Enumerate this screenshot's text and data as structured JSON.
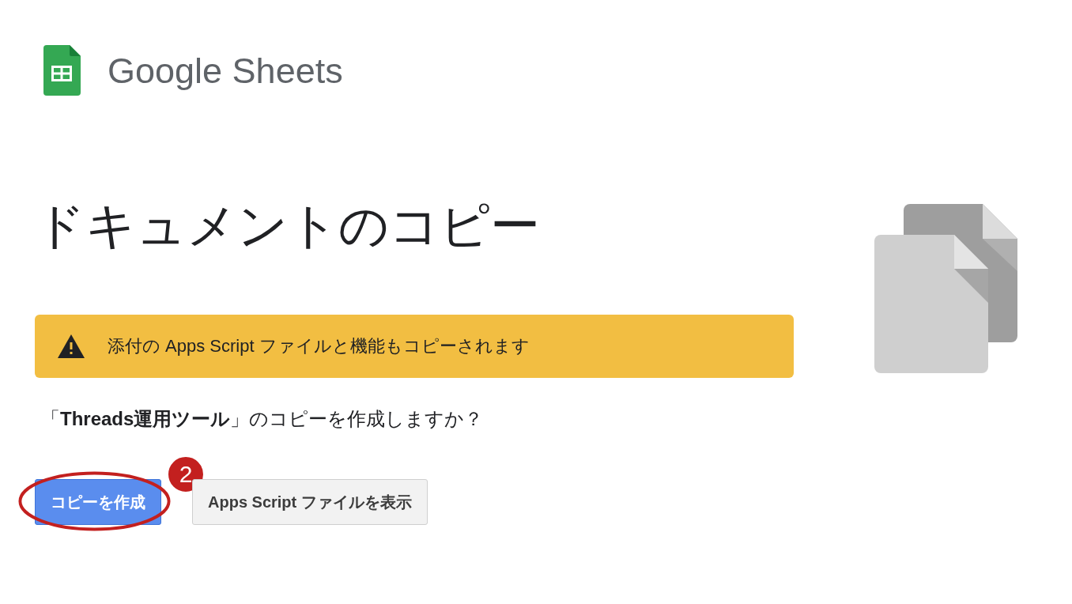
{
  "header": {
    "logo_text": "Google Sheets"
  },
  "title": "ドキュメントのコピー",
  "warning": {
    "text": "添付の Apps Script ファイルと機能もコピーされます"
  },
  "question": "「**Threads運用ツール**」のコピーを作成しますか？",
  "buttons": [
    {
      "label": "コピーを作成",
      "kind": "primary",
      "highlighted": true,
      "step": "2"
    },
    {
      "label": "Apps Script ファイルを表示",
      "kind": "secondary",
      "highlighted": false
    }
  ]
}
